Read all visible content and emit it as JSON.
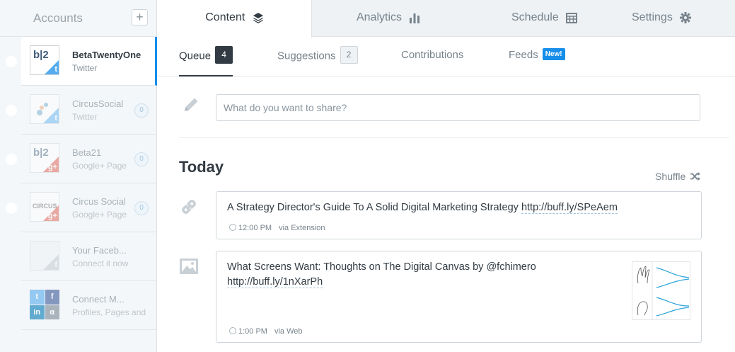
{
  "sidebar": {
    "title": "Accounts",
    "add_label": "+",
    "accounts": [
      {
        "name": "BetaTwentyOne",
        "network": "Twitter",
        "avatar_text": "b|2",
        "count": ""
      },
      {
        "name": "CircusSocial",
        "network": "Twitter",
        "avatar_text": "",
        "count": "0"
      },
      {
        "name": "Beta21",
        "network": "Google+ Page",
        "avatar_text": "b|2",
        "count": "0"
      },
      {
        "name": "Circus Social",
        "network": "Google+ Page",
        "avatar_text": "CIRCUS",
        "count": "0"
      },
      {
        "name": "Your Faceb...",
        "network": "Connect it now",
        "avatar_text": "",
        "count": ""
      },
      {
        "name": "Connect M...",
        "network": "Profiles, Pages and",
        "avatar_text": "",
        "count": ""
      }
    ]
  },
  "top_tabs": [
    {
      "label": "Content",
      "icon": "layers-icon"
    },
    {
      "label": "Analytics",
      "icon": "bar-chart-icon"
    },
    {
      "label": "Schedule",
      "icon": "calendar-icon"
    },
    {
      "label": "Settings",
      "icon": "gear-icon"
    }
  ],
  "sub_tabs": {
    "queue": {
      "label": "Queue",
      "count": "4"
    },
    "suggestions": {
      "label": "Suggestions",
      "count": "2"
    },
    "contributions": {
      "label": "Contributions"
    },
    "feeds": {
      "label": "Feeds",
      "badge": "New!"
    }
  },
  "composer": {
    "placeholder": "What do you want to share?"
  },
  "queue": {
    "day": "Today",
    "shuffle_label": "Shuffle",
    "posts": [
      {
        "text": "A Strategy Director's Guide To A Solid Digital Marketing Strategy ",
        "link": "http://buff.ly/SPeAem",
        "time": "12:00 PM",
        "via": "via Extension",
        "type_icon": "link-icon"
      },
      {
        "text": "What Screens Want: Thoughts on The Digital Canvas by @fchimero",
        "link": "http://buff.ly/1nXarPh",
        "time": "1:00 PM",
        "via": "via Web",
        "type_icon": "image-icon"
      }
    ]
  },
  "colors": {
    "accent": "#168eea",
    "twitter": "#55acee",
    "google": "#dd4b39",
    "dark": "#323b43"
  }
}
